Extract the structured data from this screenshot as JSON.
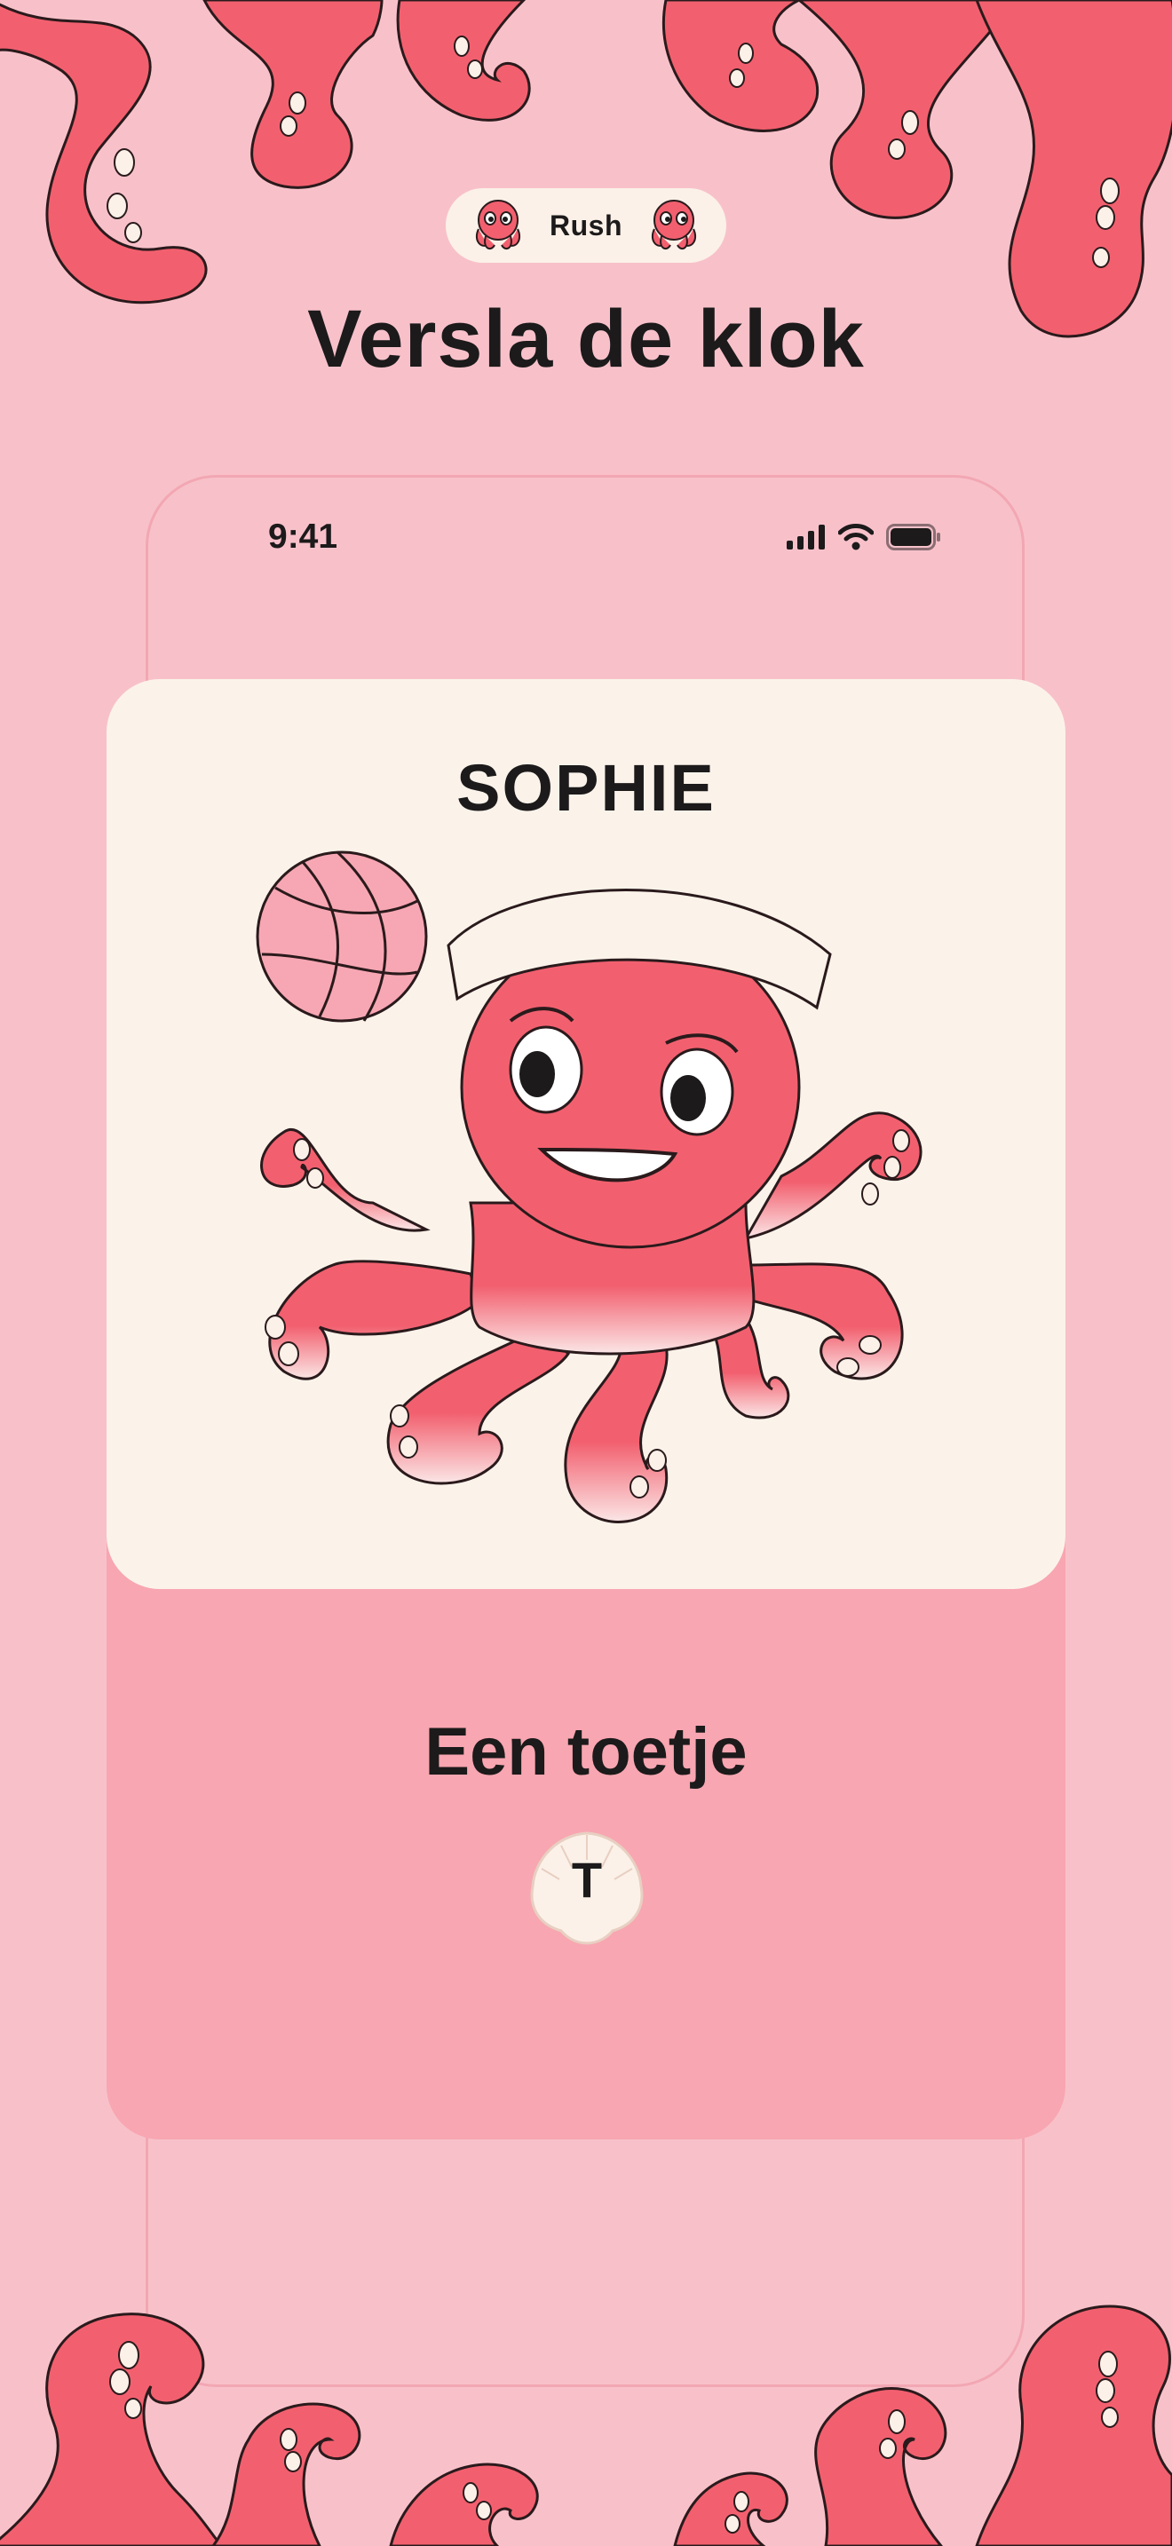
{
  "mode": {
    "label": "Rush",
    "left_icon": "octopus-mascot-icon",
    "right_icon": "octopus-mascot-icon"
  },
  "headline": "Versla de klok",
  "status_bar": {
    "time": "9:41",
    "icons": [
      "cellular-signal-icon",
      "wifi-icon",
      "battery-icon"
    ]
  },
  "player_card": {
    "name": "SOPHIE",
    "illustration": "octopus-basketball-player"
  },
  "prompt": {
    "text": "Een toetje",
    "letter": "T",
    "letter_icon": "shell-icon"
  },
  "colors": {
    "background": "#f8c1ca",
    "accent": "#f2606f",
    "card": "#fbf3ea",
    "answer_card": "#f8a6b1",
    "pill": "#fbf1e8",
    "text": "#1c1a1b"
  }
}
